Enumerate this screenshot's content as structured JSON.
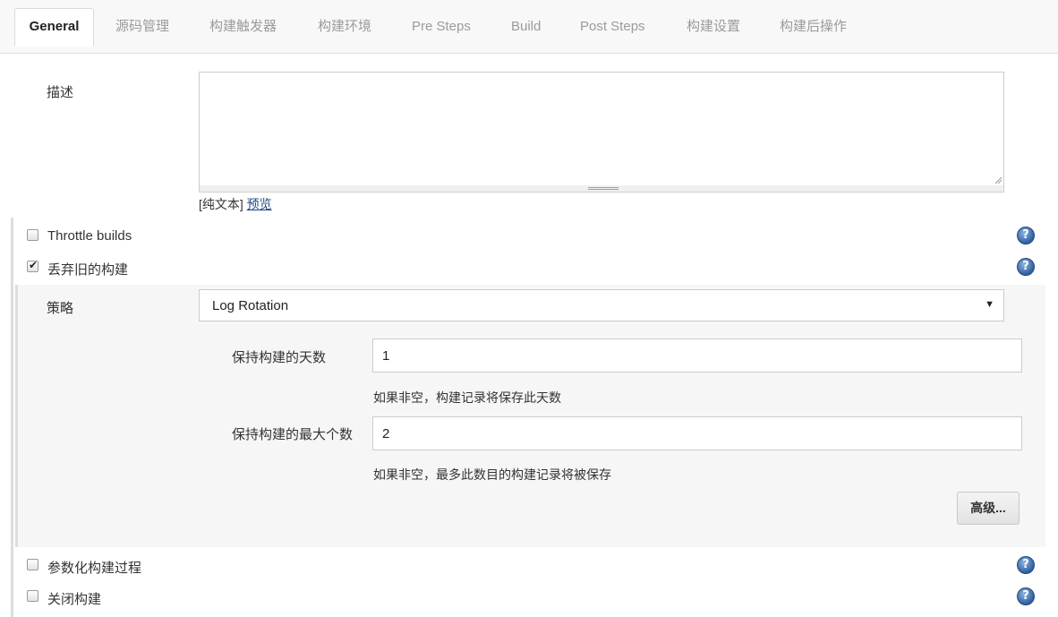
{
  "tabs": [
    {
      "label": "General",
      "active": true
    },
    {
      "label": "源码管理"
    },
    {
      "label": "构建触发器"
    },
    {
      "label": "构建环境"
    },
    {
      "label": "Pre Steps"
    },
    {
      "label": "Build"
    },
    {
      "label": "Post Steps"
    },
    {
      "label": "构建设置"
    },
    {
      "label": "构建后操作"
    }
  ],
  "description": {
    "label": "描述",
    "value": "",
    "plain_text_label": "[纯文本]",
    "preview_link": "预览"
  },
  "options": {
    "throttle_builds": {
      "label": "Throttle builds",
      "checked": false
    },
    "discard_old_builds": {
      "label": "丢弃旧的构建",
      "checked": true
    },
    "parameterized": {
      "label": "参数化构建过程",
      "checked": false
    },
    "disable_build": {
      "label": "关闭构建",
      "checked": false
    }
  },
  "strategy": {
    "label": "策略",
    "selected": "Log Rotation",
    "days_to_keep": {
      "label": "保持构建的天数",
      "value": "1",
      "hint": "如果非空，构建记录将保存此天数"
    },
    "max_builds": {
      "label": "保持构建的最大个数",
      "value": "2",
      "hint": "如果非空，最多此数目的构建记录将被保存"
    },
    "advanced_button": "高级..."
  },
  "icons": {
    "help": "help-icon",
    "check": "checkmark-icon",
    "dropdown": "dropdown-arrow-icon"
  },
  "colors": {
    "link": "#204a87",
    "help_icon": "#2f5f9e",
    "section_bg": "#f6f6f6"
  }
}
